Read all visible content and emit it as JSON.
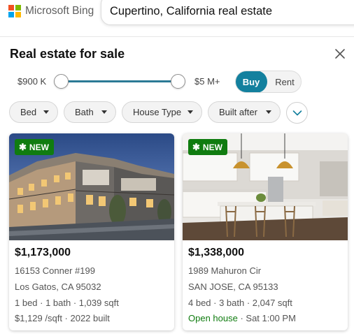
{
  "header": {
    "logo_text": "Microsoft Bing",
    "logo_colors": [
      "#f25022",
      "#7fba00",
      "#00a4ef",
      "#ffb900"
    ],
    "search_query": "Cupertino, California real estate"
  },
  "panel": {
    "title": "Real estate for sale"
  },
  "price_filter": {
    "min_label": "$900 K",
    "max_label": "$5 M+",
    "selected_range_fraction": [
      0.0,
      1.0
    ]
  },
  "toggle": {
    "buy_label": "Buy",
    "rent_label": "Rent",
    "selected": "Buy",
    "accent": "#13809e"
  },
  "filters": [
    {
      "label": "Bed"
    },
    {
      "label": "Bath"
    },
    {
      "label": "House Type"
    },
    {
      "label": "Built after"
    }
  ],
  "listings": [
    {
      "badge": "NEW",
      "price": "$1,173,000",
      "address": "16153 Conner #199",
      "city": "Los Gatos, CA 95032",
      "specs": "1 bed · 1 bath · 1,039 sqft",
      "extra": "$1,129 /sqft · 2022 built",
      "extra_highlight": ""
    },
    {
      "badge": "NEW",
      "price": "$1,338,000",
      "address": "1989 Mahuron Cir",
      "city": "SAN JOSE, CA 95133",
      "specs": "4 bed · 3 bath · 2,047 sqft",
      "extra_highlight": "Open house",
      "extra": " · Sat 1:00 PM"
    }
  ],
  "colors": {
    "badge_green": "#107c10",
    "slider_track": "#2c7a96"
  }
}
